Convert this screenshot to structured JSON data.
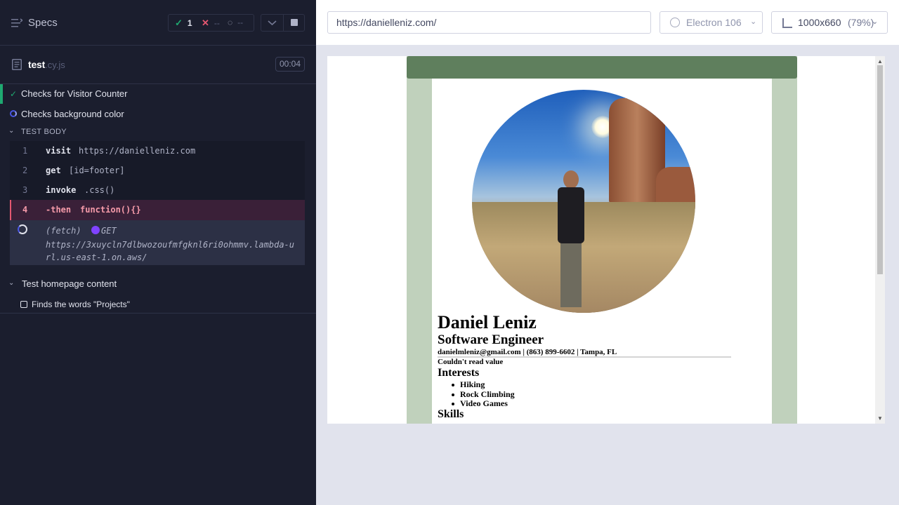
{
  "reporter": {
    "specs_label": "Specs",
    "stats": {
      "passed": "1",
      "failed": "--",
      "pending": "--"
    },
    "file": {
      "name": "test",
      "ext": ".cy.js",
      "timer": "00:04"
    },
    "tests": [
      {
        "title": "Checks for Visitor Counter",
        "state": "passed"
      },
      {
        "title": "Checks background color",
        "state": "running"
      }
    ],
    "test_body_label": "TEST BODY",
    "commands": [
      {
        "num": "1",
        "name": "visit",
        "arg": "https://danielleniz.com"
      },
      {
        "num": "2",
        "name": "get",
        "arg": "[id=footer]"
      },
      {
        "num": "3",
        "name": "invoke",
        "arg": ".css()"
      },
      {
        "num": "4",
        "name": "-then",
        "arg": "function(){}"
      }
    ],
    "fetch": {
      "label": "(fetch)",
      "method": "GET",
      "url": "https://3xuycln7dlbwozoufmfgknl6ri0ohmmv.lambda-url.us-east-1.on.aws/"
    },
    "suite": {
      "title": "Test homepage content"
    },
    "pending_test": {
      "title": "Finds the words \"Projects\""
    }
  },
  "aut": {
    "url": "https://danielleniz.com/",
    "browser": "Electron 106",
    "viewport": "1000x660",
    "zoom": "(79%)",
    "site": {
      "name": "Daniel Leniz",
      "title": "Software Engineer",
      "contact": "danielmleniz@gmail.com | (863) 899-6602 | Tampa, FL",
      "read_value": "Couldn't read value",
      "interests_heading": "Interests",
      "interests": [
        "Hiking",
        "Rock Climbing",
        "Video Games"
      ],
      "skills_heading": "Skills"
    }
  },
  "colors": {
    "passed": "#1fa971",
    "failed": "#e45770",
    "site_header": "#5f7f5d",
    "site_bg": "#c0d1bc"
  }
}
